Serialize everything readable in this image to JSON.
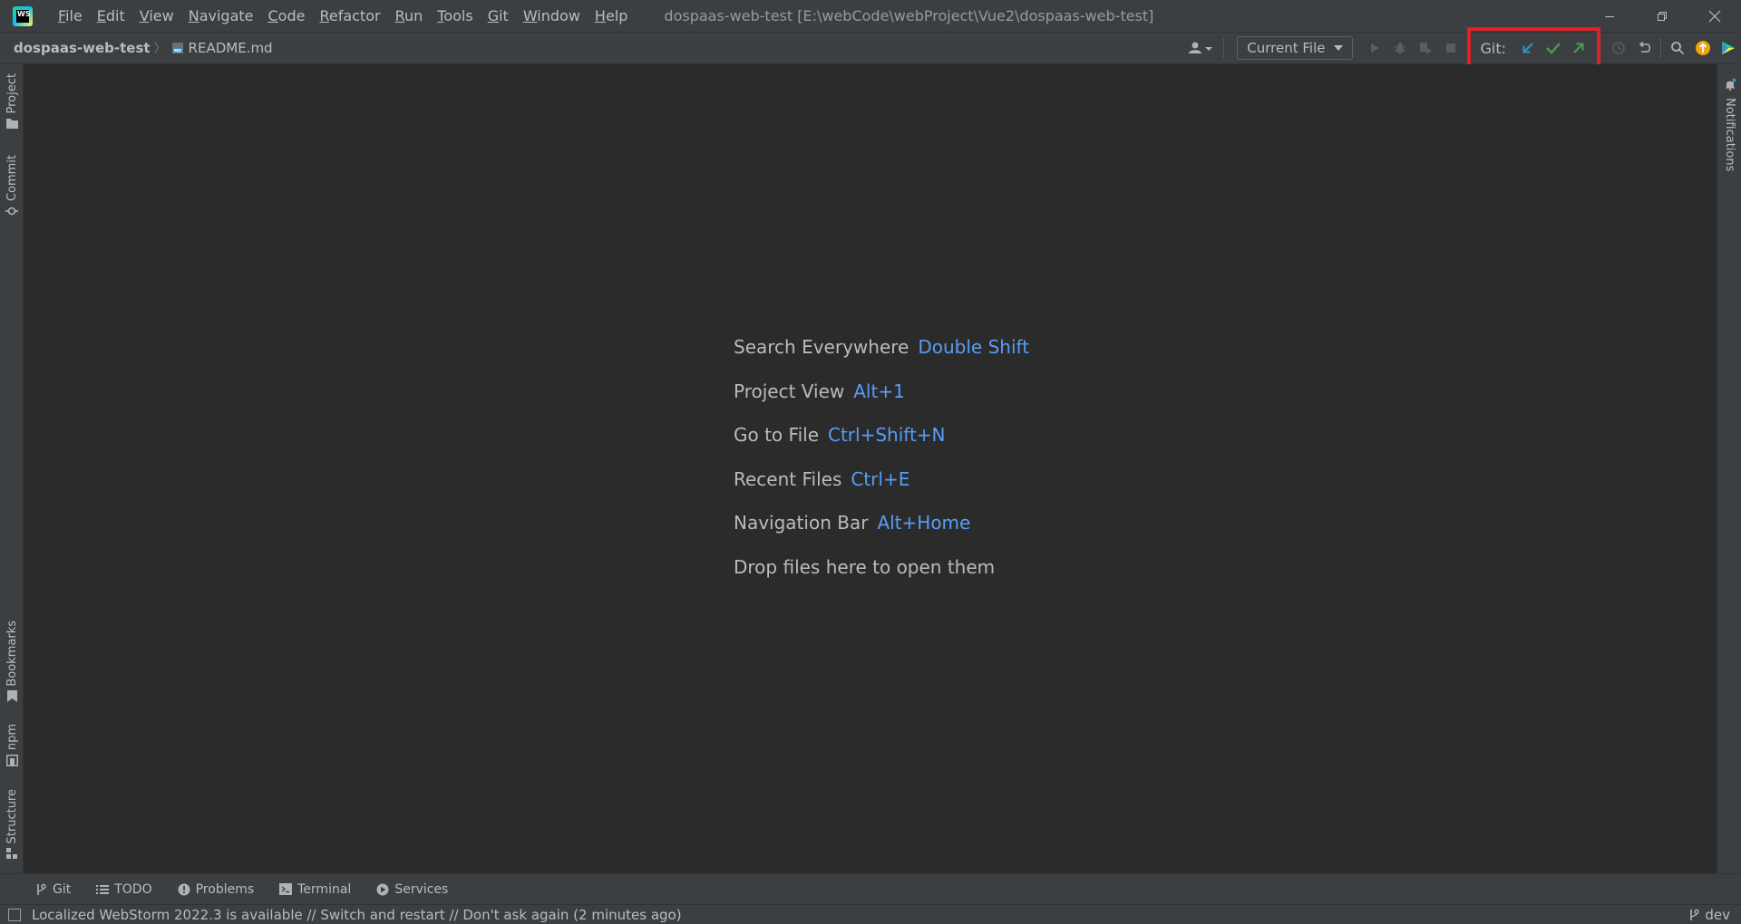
{
  "menu": {
    "items": [
      {
        "mnemonic": "F",
        "rest": "ile"
      },
      {
        "mnemonic": "E",
        "rest": "dit"
      },
      {
        "mnemonic": "V",
        "rest": "iew"
      },
      {
        "mnemonic": "N",
        "rest": "avigate"
      },
      {
        "mnemonic": "C",
        "rest": "ode"
      },
      {
        "mnemonic": "R",
        "rest": "efactor"
      },
      {
        "mnemonic": "R",
        "rest": "un"
      },
      {
        "mnemonic": "T",
        "rest": "ools"
      },
      {
        "mnemonic": "G",
        "rest": "it"
      },
      {
        "mnemonic": "W",
        "rest": "indow"
      },
      {
        "mnemonic": "H",
        "rest": "elp"
      }
    ]
  },
  "window": {
    "title": "dospaas-web-test [E:\\webCode\\webProject\\Vue2\\dospaas-web-test]",
    "logo_text": "WS"
  },
  "breadcrumb": {
    "project": "dospaas-web-test",
    "file": "README.md"
  },
  "toolbar": {
    "run_config": "Current File",
    "git_label": "Git:"
  },
  "left_stripe": {
    "project": "Project",
    "commit": "Commit",
    "bookmarks": "Bookmarks",
    "npm": "npm",
    "structure": "Structure"
  },
  "right_stripe": {
    "notifications": "Notifications"
  },
  "hints": [
    {
      "label": "Search Everywhere",
      "key": "Double Shift"
    },
    {
      "label": "Project View",
      "key": "Alt+1"
    },
    {
      "label": "Go to File",
      "key": "Ctrl+Shift+N"
    },
    {
      "label": "Recent Files",
      "key": "Ctrl+E"
    },
    {
      "label": "Navigation Bar",
      "key": "Alt+Home"
    },
    {
      "label": "Drop files here to open them",
      "key": ""
    }
  ],
  "bottom_tabs": {
    "git": "Git",
    "todo": "TODO",
    "problems": "Problems",
    "terminal": "Terminal",
    "services": "Services"
  },
  "status": {
    "message": "Localized WebStorm 2022.3 is available // Switch and restart // Don't ask again (2 minutes ago)",
    "branch": "dev"
  },
  "colors": {
    "accent": "#589df6",
    "git_update": "#3592c4",
    "git_commit": "#499c54",
    "git_push": "#499c54",
    "highlight_box": "#e0202a",
    "update_badge": "#f0a30a"
  }
}
